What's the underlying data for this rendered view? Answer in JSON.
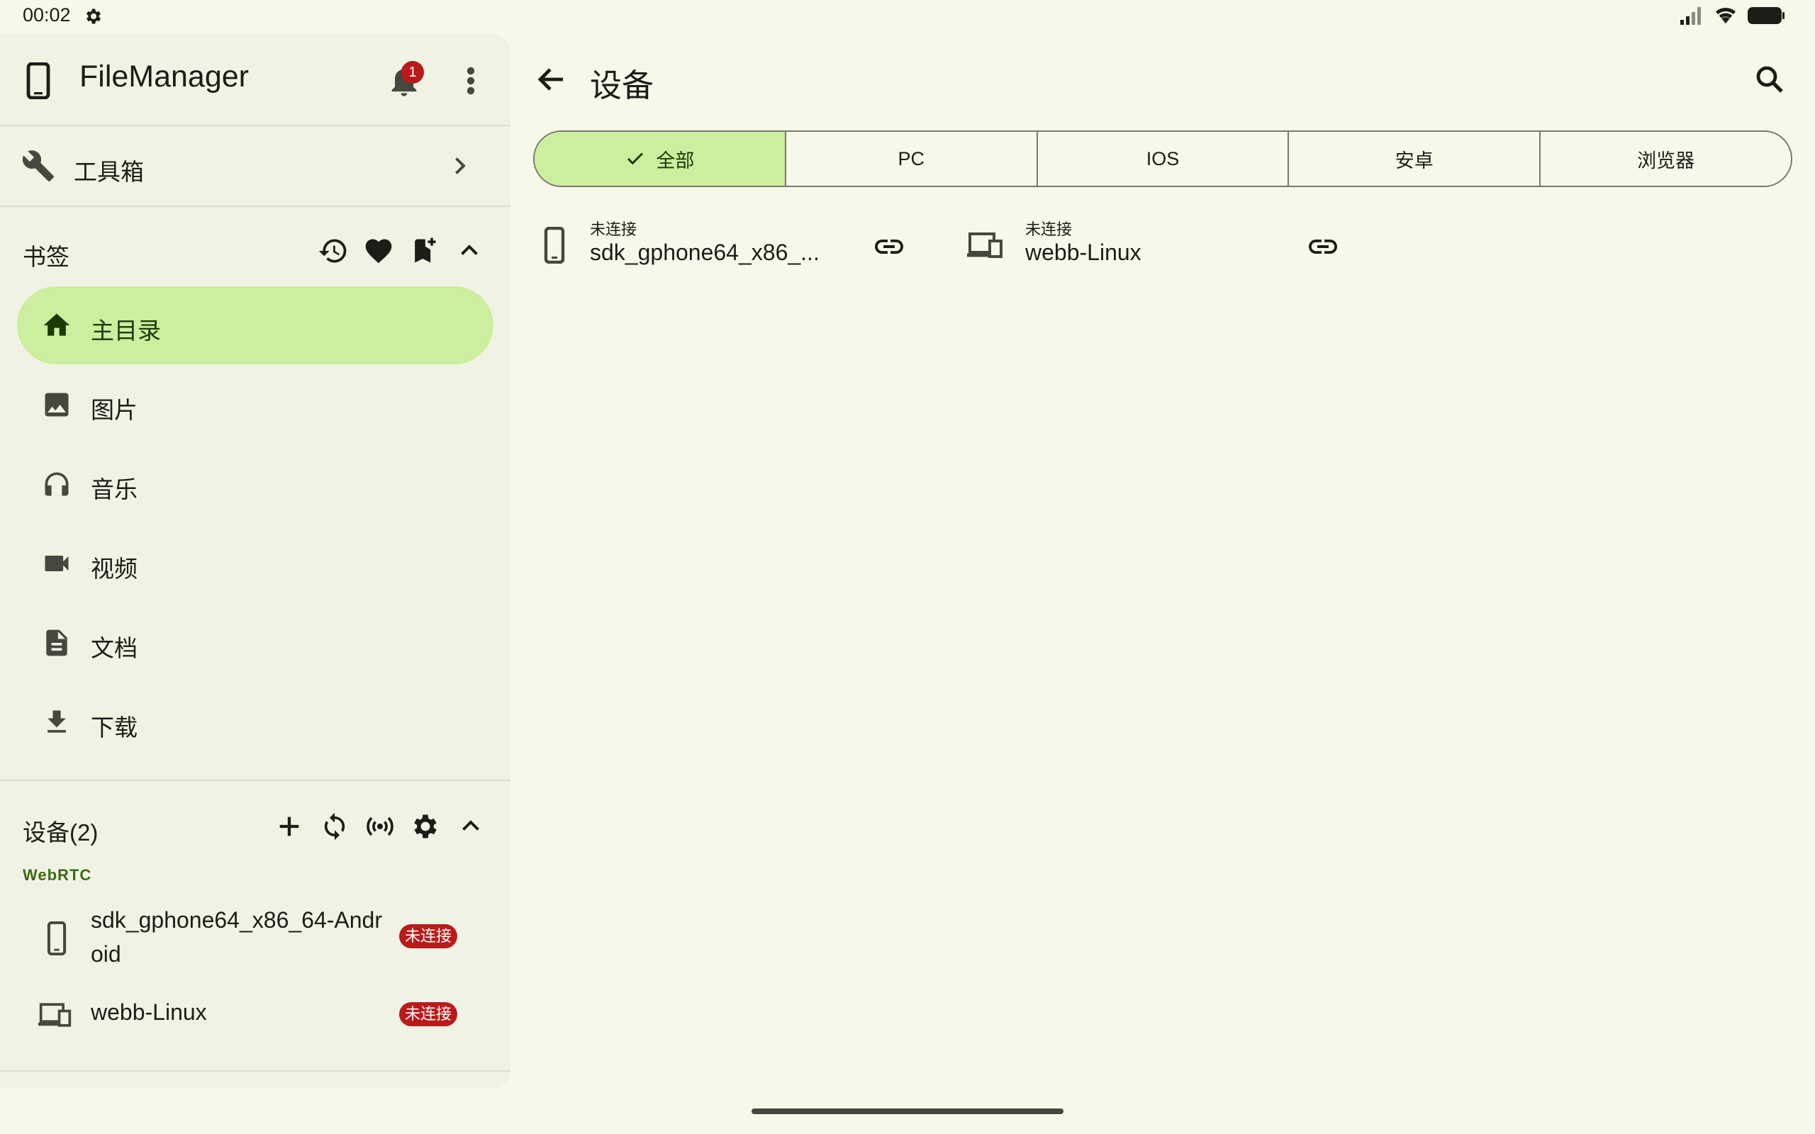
{
  "status_bar": {
    "time": "00:02",
    "icons": [
      "settings-icon",
      "signal-icon",
      "wifi-icon",
      "battery-icon"
    ]
  },
  "drawer": {
    "app_title": "FileManager",
    "notification_count": "1",
    "toolbox_label": "工具箱",
    "bookmarks": {
      "title": "书签",
      "items": [
        {
          "label": "主目录",
          "icon": "home-icon",
          "active": true
        },
        {
          "label": "图片",
          "icon": "image-icon"
        },
        {
          "label": "音乐",
          "icon": "headphones-icon"
        },
        {
          "label": "视频",
          "icon": "videocam-icon"
        },
        {
          "label": "文档",
          "icon": "document-icon"
        },
        {
          "label": "下载",
          "icon": "download-icon"
        }
      ]
    },
    "devices": {
      "title": "设备(2)",
      "group": "WebRTC",
      "items": [
        {
          "name": "sdk_gphone64_x86_64-Android",
          "status": "未连接",
          "icon": "phone-icon"
        },
        {
          "name": "webb-Linux",
          "status": "未连接",
          "icon": "devices-icon"
        }
      ]
    }
  },
  "main": {
    "title": "设备",
    "filters": [
      "全部",
      "PC",
      "IOS",
      "安卓",
      "浏览器"
    ],
    "selected_filter": "全部",
    "devices": [
      {
        "status": "未连接",
        "name": "sdk_gphone64_x86_...",
        "icon": "phone-icon"
      },
      {
        "status": "未连接",
        "name": "webb-Linux",
        "icon": "devices-icon"
      }
    ]
  },
  "colors": {
    "accent": "#cbee9f",
    "background": "#f6f9ea",
    "drawer": "#f0f3e4",
    "badge": "#ba1a1a",
    "group_label": "#3d6a13"
  }
}
